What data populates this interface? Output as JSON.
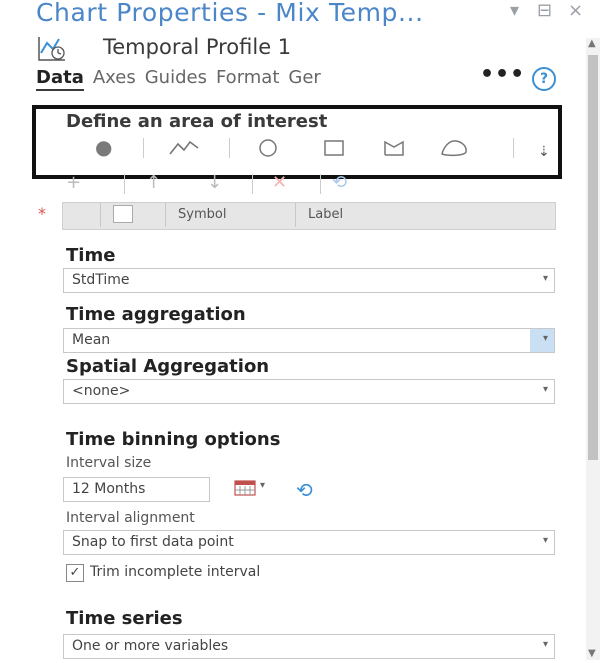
{
  "window": {
    "title": "Chart Properties - Mix Temp...",
    "pin_icon": "pin-icon",
    "float_icon": "float-icon",
    "close_glyph": "×"
  },
  "chart": {
    "name": "Temporal Profile 1",
    "icon": "temporal-profile-icon"
  },
  "tabs": [
    {
      "label": "Data",
      "active": true
    },
    {
      "label": "Axes"
    },
    {
      "label": "Guides"
    },
    {
      "label": "Format"
    },
    {
      "label": "Ger"
    }
  ],
  "more_label": "•••",
  "help_label": "?",
  "aoi": {
    "label": "Define an area of interest",
    "tools": [
      "point-icon",
      "line-icon",
      "circle-icon",
      "rectangle-icon",
      "lasso-icon",
      "polygon-icon",
      "overflow-icon"
    ]
  },
  "grid_toolbar": [
    "add-icon",
    "move-up-icon",
    "move-down-icon",
    "delete-icon",
    "undo-icon"
  ],
  "grid": {
    "asterisk": "*",
    "columns": [
      "Symbol",
      "Label"
    ]
  },
  "time": {
    "label": "Time",
    "value": "StdTime"
  },
  "time_aggregation": {
    "label": "Time aggregation",
    "value": "Mean"
  },
  "spatial_aggregation": {
    "label": "Spatial Aggregation",
    "value": "<none>"
  },
  "time_binning": {
    "label": "Time binning options",
    "interval_size_label": "Interval size",
    "interval_size_value": "12 Months",
    "interval_alignment_label": "Interval alignment",
    "interval_alignment_value": "Snap to first data point",
    "trim_label": "Trim incomplete interval",
    "trim_checked": true,
    "check_glyph": "✓"
  },
  "time_series": {
    "label": "Time series",
    "value": "One or more variables"
  },
  "colors": {
    "accent": "#3a90d4",
    "title": "#4a86c8",
    "highlight": "#c9dff3"
  }
}
